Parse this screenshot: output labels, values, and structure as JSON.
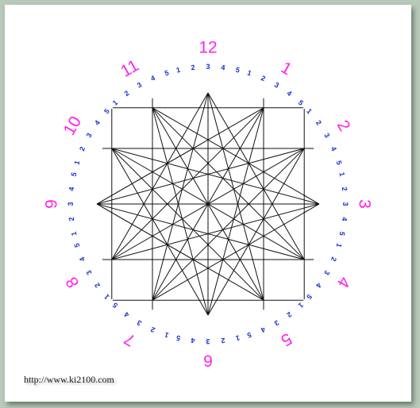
{
  "hours": [
    "12",
    "1",
    "2",
    "3",
    "4",
    "5",
    "6",
    "7",
    "8",
    "9",
    "10",
    "11"
  ],
  "sub_ticks": [
    "1",
    "2",
    "3",
    "4",
    "5"
  ],
  "watermark": "http://www.ki2100.com",
  "colors": {
    "hour": "#ff22ee",
    "tick": "#1a2fd0",
    "line": "#111111",
    "background": "#b9cabb",
    "paper": "#ffffff"
  },
  "connections": [
    [
      0,
      4
    ],
    [
      0,
      5
    ],
    [
      0,
      7
    ],
    [
      0,
      8
    ],
    [
      1,
      5
    ],
    [
      1,
      6
    ],
    [
      1,
      8
    ],
    [
      1,
      9
    ],
    [
      2,
      6
    ],
    [
      2,
      7
    ],
    [
      2,
      9
    ],
    [
      2,
      10
    ],
    [
      3,
      7
    ],
    [
      3,
      8
    ],
    [
      3,
      10
    ],
    [
      3,
      11
    ],
    [
      4,
      8
    ],
    [
      4,
      9
    ],
    [
      4,
      11
    ],
    [
      5,
      9
    ],
    [
      5,
      10
    ],
    [
      6,
      10
    ],
    [
      6,
      11
    ],
    [
      7,
      11
    ]
  ]
}
